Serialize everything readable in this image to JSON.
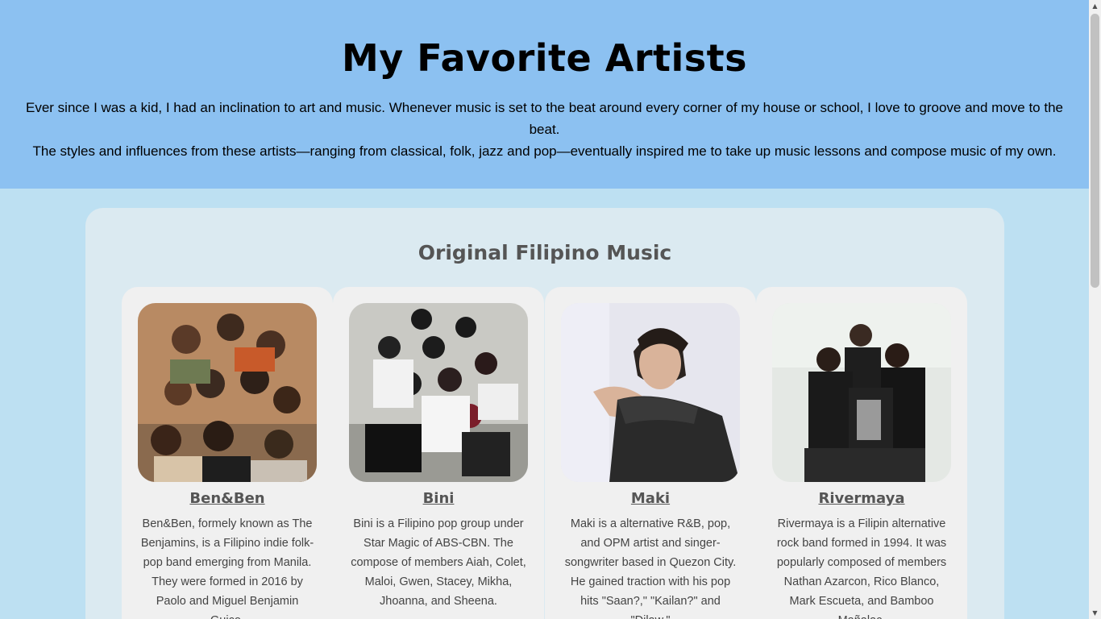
{
  "header": {
    "title": "My Favorite Artists",
    "intro_line1": "Ever since I was a kid, I had an inclination to art and music. Whenever music is set to the beat around every corner of my house or school, I love to groove and move to the beat.",
    "intro_line2": "The styles and influences from these artists—ranging from classical, folk, jazz and pop—eventually inspired me to take up music lessons and compose music of my own."
  },
  "section": {
    "title": "Original Filipino Music"
  },
  "artists": [
    {
      "name": "Ben&Ben",
      "description": "Ben&Ben, formely known as The Benjamins, is a Filipino indie folk-pop band emerging from Manila. They were formed in 2016 by Paolo and Miguel Benjamin Guico."
    },
    {
      "name": "Bini",
      "description": "Bini is a Filipino pop group under Star Magic of ABS-CBN. The compose of members Aiah, Colet, Maloi, Gwen, Stacey, Mikha, Jhoanna, and Sheena."
    },
    {
      "name": "Maki",
      "description": "Maki is a alternative R&B, pop, and OPM artist and singer-songwriter based in Quezon City. He gained traction with his pop hits \"Saan?,\" \"Kailan?\" and \"Dilaw.\""
    },
    {
      "name": "Rivermaya",
      "description": "Rivermaya is a Filipin alternative rock band formed in 1994. It was popularly composed of members Nathan Azarcon, Rico Blanco, Mark Escueta, and Bamboo Mañalac."
    }
  ],
  "icons": {
    "scroll_up": "scroll-up-arrow-icon",
    "scroll_down": "scroll-down-arrow-icon"
  },
  "colors": {
    "header_bg": "#8cc1f1",
    "page_bg": "#bde0f2",
    "panel_bg": "#dbeaf1",
    "card_bg": "#f0f0f0"
  }
}
